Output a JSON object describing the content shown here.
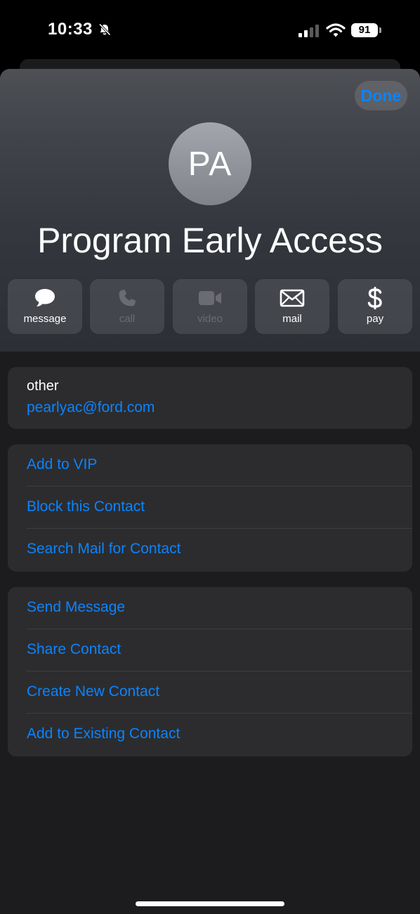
{
  "status_bar": {
    "time": "10:33",
    "battery": "91",
    "icons": [
      "bell-slash-icon",
      "cellular-signal-icon",
      "wifi-icon",
      "battery-icon"
    ]
  },
  "header": {
    "done_label": "Done",
    "avatar_initials": "PA",
    "contact_name": "Program Early Access"
  },
  "actions": [
    {
      "label": "message",
      "icon": "message-bubble-icon",
      "enabled": true
    },
    {
      "label": "call",
      "icon": "phone-icon",
      "enabled": false
    },
    {
      "label": "video",
      "icon": "video-camera-icon",
      "enabled": false
    },
    {
      "label": "mail",
      "icon": "envelope-icon",
      "enabled": true
    },
    {
      "label": "pay",
      "icon": "dollar-icon",
      "enabled": true
    }
  ],
  "email_card": {
    "label": "other",
    "value": "pearlyac@ford.com"
  },
  "options_group_1": [
    {
      "label": "Add to VIP"
    },
    {
      "label": "Block this Contact"
    },
    {
      "label": "Search Mail for Contact"
    }
  ],
  "options_group_2": [
    {
      "label": "Send Message"
    },
    {
      "label": "Share Contact"
    },
    {
      "label": "Create New Contact"
    },
    {
      "label": "Add to Existing Contact"
    }
  ],
  "colors": {
    "accent": "#0a84ff",
    "background": "#1c1c1e",
    "card": "#2c2c2e"
  }
}
